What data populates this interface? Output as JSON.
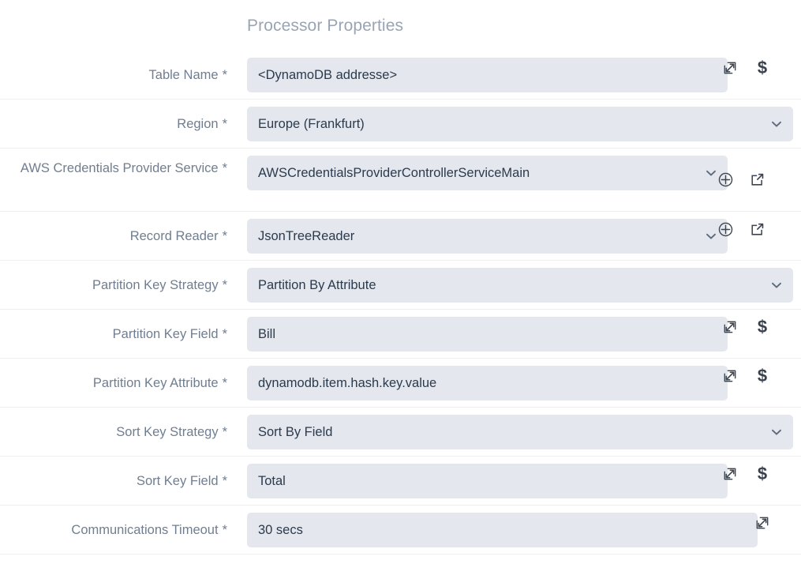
{
  "panel": {
    "title": "Processor Properties"
  },
  "colors": {
    "field_background": "#e4e8ee",
    "field_text": "#2b3a4d",
    "label_text": "#6f7e91",
    "title_text": "#9aa4b4",
    "divider": "#eceef1",
    "icon": "#3c4450",
    "page_background": "#ffffff"
  },
  "required_marker": "*",
  "properties": [
    {
      "label": "Table Name",
      "required": true,
      "control": "text",
      "value": "<DynamoDB addresse>",
      "actions": [
        "expand-icon",
        "expression-language-icon"
      ]
    },
    {
      "label": "Region",
      "required": true,
      "control": "select",
      "value": "Europe (Frankfurt)",
      "actions": []
    },
    {
      "label": "AWS Credentials Provider Service",
      "required": true,
      "control": "select",
      "value": "AWSCredentialsProviderControllerServiceMain",
      "actions": [
        "add-service-icon",
        "go-to-service-icon"
      ]
    },
    {
      "label": "Record Reader",
      "required": true,
      "control": "select",
      "value": "JsonTreeReader",
      "actions": [
        "add-service-icon",
        "go-to-service-icon"
      ]
    },
    {
      "label": "Partition Key Strategy",
      "required": true,
      "control": "select",
      "value": "Partition By Attribute",
      "actions": []
    },
    {
      "label": "Partition Key Field",
      "required": true,
      "control": "text",
      "value": "Bill",
      "actions": [
        "expand-icon",
        "expression-language-icon"
      ]
    },
    {
      "label": "Partition Key Attribute",
      "required": true,
      "control": "text",
      "value": "dynamodb.item.hash.key.value",
      "actions": [
        "expand-icon",
        "expression-language-icon"
      ]
    },
    {
      "label": "Sort Key Strategy",
      "required": true,
      "control": "select",
      "value": "Sort By Field",
      "actions": []
    },
    {
      "label": "Sort Key Field",
      "required": true,
      "control": "text",
      "value": "Total",
      "actions": [
        "expand-icon",
        "expression-language-icon"
      ]
    },
    {
      "label": "Communications Timeout",
      "required": true,
      "control": "text",
      "value": "30 secs",
      "actions": [
        "expand-icon"
      ]
    }
  ],
  "icon_glyphs": {
    "expression_language": "$"
  }
}
